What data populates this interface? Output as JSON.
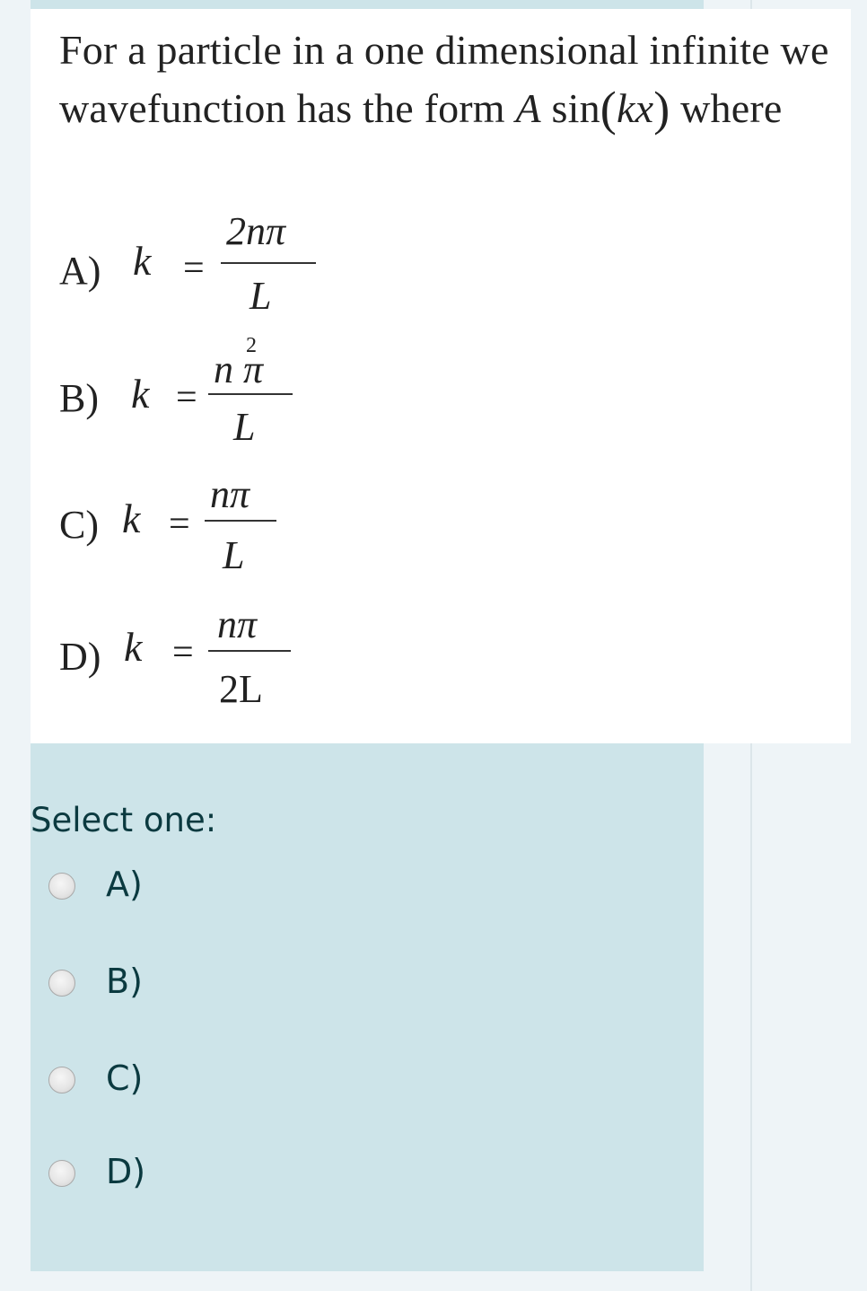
{
  "question": {
    "line1": "For a particle in a one dimensional infinite we",
    "line2_prefix": "wavefunction has the form ",
    "line2_A": "A",
    "line2_sin": " sin",
    "line2_open": "(",
    "line2_kx": "kx",
    "line2_close": ")",
    "line2_suffix": " where"
  },
  "options": [
    {
      "letter": "A)",
      "k": "k",
      "eq": "=",
      "num": "2nπ",
      "num_sup": "",
      "den": "L"
    },
    {
      "letter": "B)",
      "k": "k",
      "eq": "=",
      "num": "n π",
      "num_sup": "2",
      "den": "L"
    },
    {
      "letter": "C)",
      "k": "k",
      "eq": "=",
      "num": "nπ",
      "num_sup": "",
      "den": "L"
    },
    {
      "letter": "D)",
      "k": "k",
      "eq": "=",
      "num": "nπ",
      "num_sup": "",
      "den": "2L"
    }
  ],
  "answer": {
    "prompt": "Select one:",
    "choices": [
      "A)",
      "B)",
      "C)",
      "D)"
    ]
  }
}
